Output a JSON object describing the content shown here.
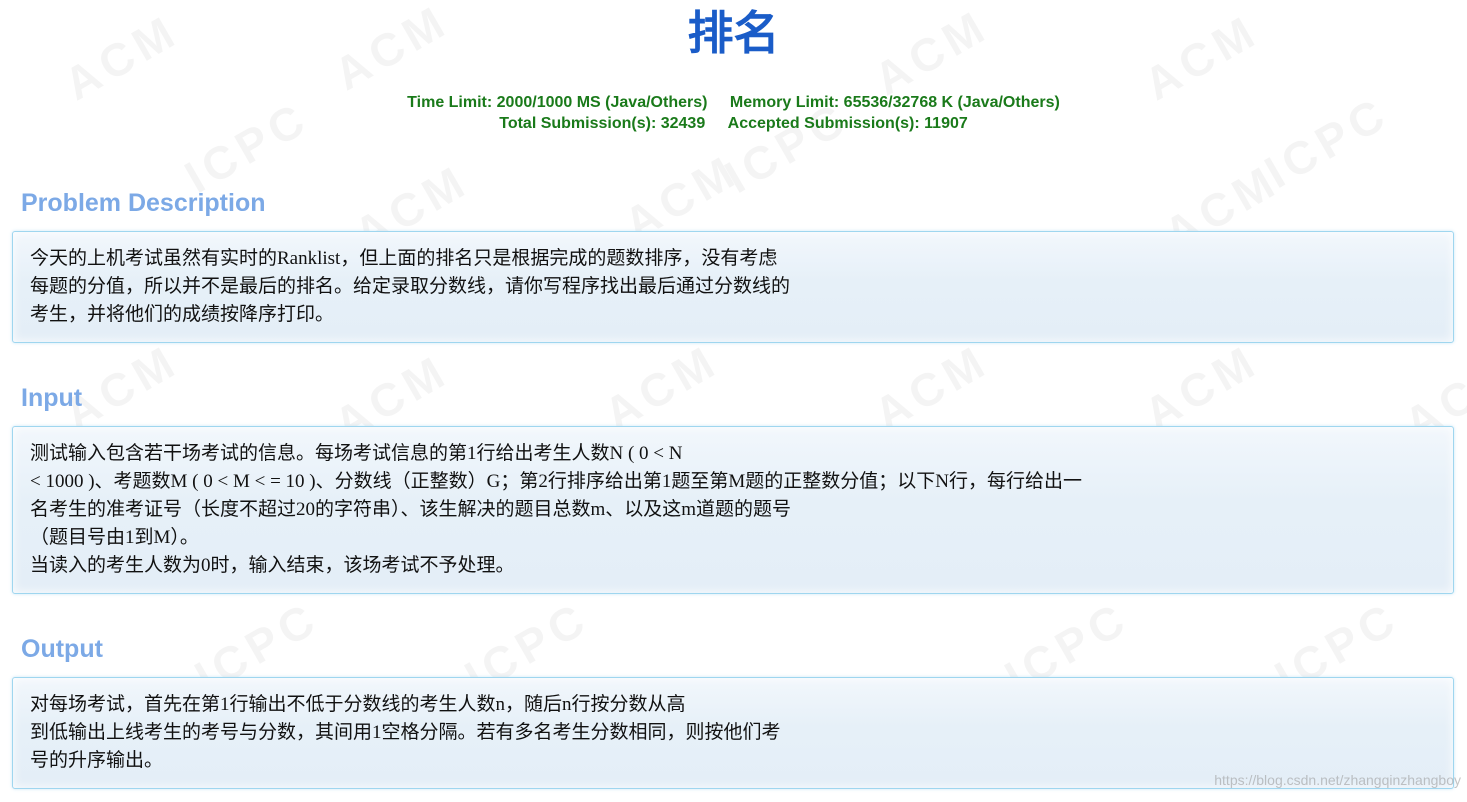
{
  "problem": {
    "title": "排名",
    "time_limit": "Time Limit: 2000/1000 MS (Java/Others)",
    "memory_limit": "Memory Limit: 65536/32768 K (Java/Others)",
    "total_submissions": "Total Submission(s): 32439",
    "accepted_submissions": "Accepted Submission(s): 11907"
  },
  "sections": {
    "description": {
      "heading": "Problem Description",
      "lines": [
        "今天的上机考试虽然有实时的Ranklist，但上面的排名只是根据完成的题数排序，没有考虑",
        "每题的分值，所以并不是最后的排名。给定录取分数线，请你写程序找出最后通过分数线的",
        "考生，并将他们的成绩按降序打印。"
      ]
    },
    "input": {
      "heading": "Input",
      "lines": [
        "测试输入包含若干场考试的信息。每场考试信息的第1行给出考生人数N ( 0 < N",
        "< 1000 )、考题数M ( 0 < M < = 10 )、分数线（正整数）G；第2行排序给出第1题至第M题的正整数分值；以下N行，每行给出一",
        "名考生的准考证号（长度不超过20的字符串）、该生解决的题目总数m、以及这m道题的题号",
        "（题目号由1到M）。",
        "当读入的考生人数为0时，输入结束，该场考试不予处理。"
      ]
    },
    "output": {
      "heading": "Output",
      "lines": [
        "对每场考试，首先在第1行输出不低于分数线的考生人数n，随后n行按分数从高",
        "到低输出上线考生的考号与分数，其间用1空格分隔。若有多名考生分数相同，则按他们考",
        "号的升序输出。"
      ]
    }
  },
  "watermark": {
    "tokens": [
      "ACM",
      "ICPC"
    ],
    "source_url": "https://blog.csdn.net/zhangqinzhangboy"
  },
  "colors": {
    "title": "#1a5cc8",
    "limits": "#1a7a1a",
    "section_heading": "#7ca9e6",
    "panel_border": "#9fd6ef",
    "panel_bg": "#e6f0f8"
  }
}
